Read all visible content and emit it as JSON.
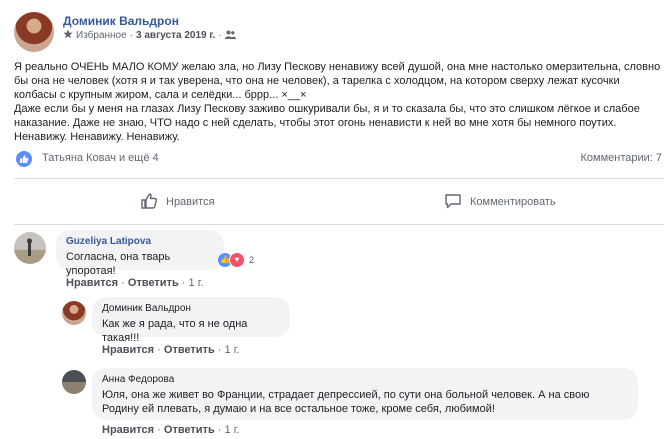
{
  "post": {
    "author": "Доминик Вальдрон",
    "visibility": "Избранное",
    "separator": "·",
    "date": "3 августа 2019 г.",
    "privacy_icon": "people-icon",
    "text_line1": "Я реально ОЧЕНЬ МАЛО КОМУ желаю зла, но Лизу Пескову ненавижу всей душой, она мне настолько омерзительна, словно бы она не человек (хотя я и так уверена, что она не человек), а тарелка с холодцом, на котором сверху лежат кусочки колбасы с крупным жиром, сала и селёдки... бррр... ×__×",
    "text_line2": "Даже если бы у меня на глазах Лизу Пескову заживо ошкуривали бы, я и то сказала бы, что это слишком лёгкое и слабое наказание. Даже не знаю, ЧТО надо с ней сделать, чтобы этот огонь ненависти к ней во мне хотя бы немного поутих. Ненавижу. Ненавижу. Ненавижу."
  },
  "reactions": {
    "names": "Татьяна Ковач и ещё 4",
    "comments": "Комментарии: 7"
  },
  "actions": {
    "like": "Нравится",
    "comment": "Комментировать"
  },
  "comments": [
    {
      "author": "Guzeliya Latipova",
      "text": "Согласна, она тварь упоротая!",
      "like": "Нравится",
      "reply": "Ответить",
      "time": "1 г.",
      "reaction_count": "2"
    },
    {
      "author": "Доминик Вальдрон",
      "text": "Как же я рада, что я не одна такая!!!",
      "like": "Нравится",
      "reply": "Ответить",
      "time": "1 г."
    },
    {
      "author": "Анна Федорова",
      "text": "Юля, она же живет во Франции, страдает депрессией, по сути она больной человек. А на свою Родину ей плевать, я думаю и на все остальное тоже, кроме себя, любимой!",
      "like": "Нравится",
      "reply": "Ответить",
      "time": "1 г."
    }
  ],
  "dot": "·",
  "colors": {
    "link": "#385898",
    "like_blue": "#5890ff",
    "love_red": "#f25268",
    "bubble": "#f2f3f5"
  }
}
